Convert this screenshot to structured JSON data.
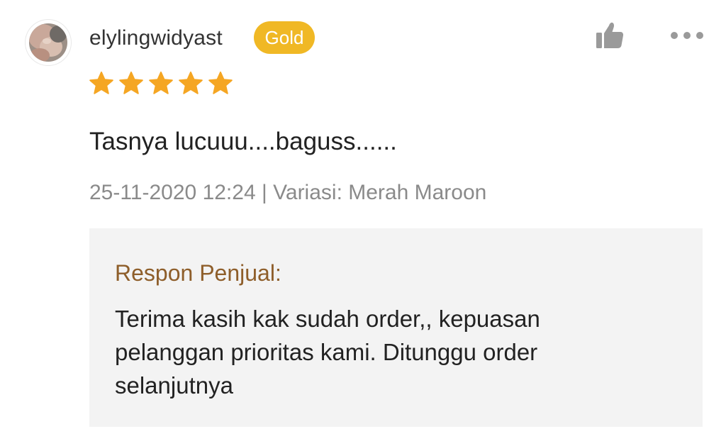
{
  "review": {
    "username": "elylingwidyast",
    "tier_badge": "Gold",
    "rating": 5,
    "rating_max": 5,
    "star_color": "#f5a623",
    "text": "Tasnya lucuuu....baguss......",
    "meta": "25-11-2020 12:24 | Variasi: Merah Maroon"
  },
  "icons": {
    "like": "thumbs-up-icon",
    "more": "more-dots-icon",
    "avatar": "user-avatar"
  },
  "seller_response": {
    "title": "Respon Penjual:",
    "text": "Terima kasih kak sudah order,, kepuasan pelanggan prioritas kami. Ditunggu order selanjutnya"
  },
  "colors": {
    "badge": "#f0b825",
    "seller_title": "#8e5e2a",
    "meta_text": "#8a8a8a"
  }
}
